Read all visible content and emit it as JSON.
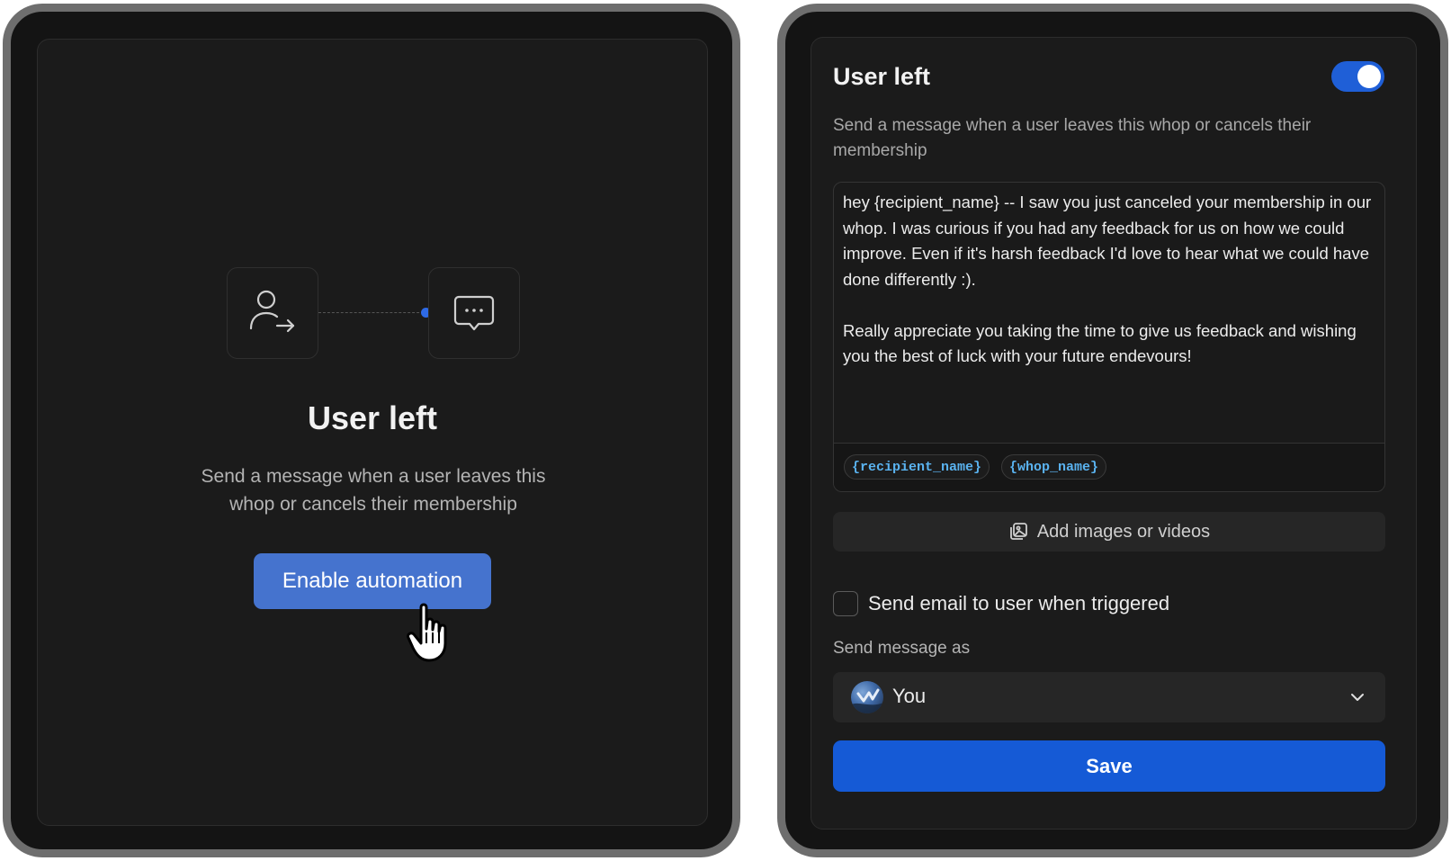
{
  "left_panel": {
    "title": "User left",
    "description": "Send a message when a user leaves this whop or cancels their membership",
    "enable_button_label": "Enable automation",
    "flow": {
      "trigger_icon": "user-leave-icon",
      "action_icon": "message-bubble-icon"
    }
  },
  "right_panel": {
    "title": "User left",
    "toggle_enabled": true,
    "description": "Send a message when a user leaves this whop or cancels their membership",
    "message": "hey {recipient_name} -- I saw you just canceled your membership in our whop. I was curious if you had any feedback for us on how we could improve. Even if it's harsh feedback I'd love to hear what we could have done differently :).\n\nReally appreciate you taking the time to give us feedback and wishing you the best of luck with your future endevours!",
    "variables": [
      "{recipient_name}",
      "{whop_name}"
    ],
    "add_media_label": "Add images or videos",
    "email_checkbox_label": "Send email to user when triggered",
    "email_checked": false,
    "send_as_label": "Send message as",
    "sender": "You",
    "save_label": "Save"
  },
  "colors": {
    "accent": "#155ad6",
    "enable_button": "#4573ce",
    "variable_text": "#5ab3f0"
  }
}
